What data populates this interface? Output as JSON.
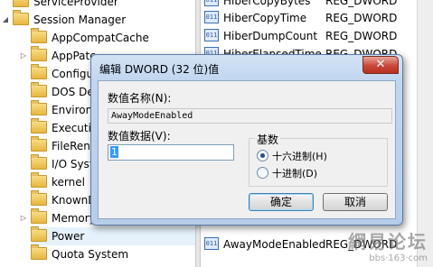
{
  "tree": {
    "items": [
      {
        "label": "ServiceProvider",
        "level": 0,
        "expander": ""
      },
      {
        "label": "Session Manager",
        "level": 0,
        "expander": "◢"
      },
      {
        "label": "AppCompatCache",
        "level": 1,
        "expander": ""
      },
      {
        "label": "AppPatc",
        "level": 1,
        "expander": "▷"
      },
      {
        "label": "Configur",
        "level": 1,
        "expander": ""
      },
      {
        "label": "DOS Dev",
        "level": 1,
        "expander": ""
      },
      {
        "label": "Environm",
        "level": 1,
        "expander": ""
      },
      {
        "label": "Executive",
        "level": 1,
        "expander": ""
      },
      {
        "label": "FileRenar",
        "level": 1,
        "expander": ""
      },
      {
        "label": "I/O Syste",
        "level": 1,
        "expander": ""
      },
      {
        "label": "kernel",
        "level": 1,
        "expander": ""
      },
      {
        "label": "KnownDl",
        "level": 1,
        "expander": ""
      },
      {
        "label": "Memory",
        "level": 1,
        "expander": "▷"
      },
      {
        "label": "Power",
        "level": 1,
        "expander": ""
      },
      {
        "label": "Quota System",
        "level": 1,
        "expander": ""
      }
    ]
  },
  "values": {
    "rows": [
      {
        "name": "HiberCopyBytes",
        "type": "REG_DWORD"
      },
      {
        "name": "HiberCopyTime",
        "type": "REG_DWORD"
      },
      {
        "name": "HiberDumpCount",
        "type": "REG_DWORD"
      },
      {
        "name": "HiberElapsedTime",
        "type": "REG_DWORD"
      },
      {
        "name": "AwayModeEnabled",
        "type": "REG_DWORD"
      }
    ]
  },
  "dialog": {
    "title": "编辑 DWORD (32 位)值",
    "close_glyph": "✕",
    "name_label": "数值名称(N):",
    "name_value": "AwayModeEnabled",
    "data_label": "数值数据(V):",
    "data_value": "1",
    "base_label": "基数",
    "radio_hex": "十六进制(H)",
    "radio_dec": "十进制(D)",
    "selected_base": "hex",
    "ok_label": "确定",
    "cancel_label": "取消"
  },
  "watermark": {
    "line1": "網易论坛",
    "line2": "bbs·163·com"
  }
}
